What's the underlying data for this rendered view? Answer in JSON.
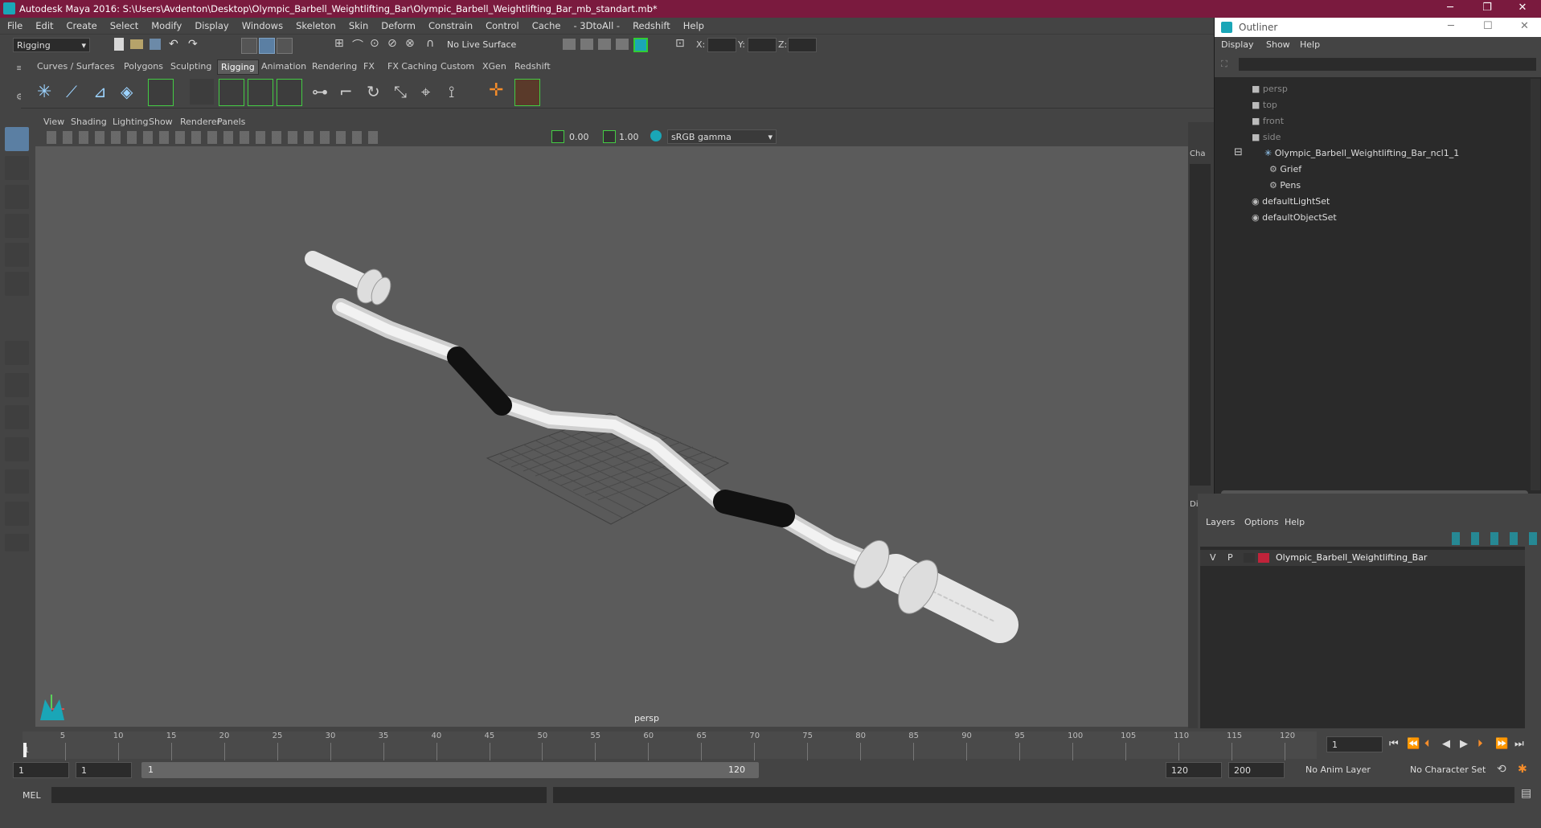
{
  "window": {
    "title": "Autodesk Maya 2016: S:\\Users\\Avdenton\\Desktop\\Olympic_Barbell_Weightlifting_Bar\\Olympic_Barbell_Weightlifting_Bar_mb_standart.mb*"
  },
  "menubar": [
    "File",
    "Edit",
    "Create",
    "Select",
    "Modify",
    "Display",
    "Windows",
    "Skeleton",
    "Skin",
    "Deform",
    "Constrain",
    "Control",
    "Cache",
    "- 3DtoAll -",
    "Redshift",
    "Help"
  ],
  "statusline": {
    "mode": "Rigging",
    "live_surface": "No Live Surface",
    "x_label": "X:",
    "y_label": "Y:",
    "z_label": "Z:"
  },
  "shelf_tabs": [
    "Curves / Surfaces",
    "Polygons",
    "Sculpting",
    "Rigging",
    "Animation",
    "Rendering",
    "FX",
    "FX Caching",
    "Custom",
    "XGen",
    "Redshift"
  ],
  "shelf_active": "Rigging",
  "panel_menu": [
    "View",
    "Shading",
    "Lighting",
    "Show",
    "Renderer",
    "Panels"
  ],
  "panel_tools": {
    "exposure": "0.00",
    "gamma": "1.00",
    "color_space": "sRGB gamma"
  },
  "viewport": {
    "camera_label": "persp"
  },
  "sideband": {
    "top_label": "Cha",
    "bottom_label": "Dis"
  },
  "outliner": {
    "title": "Outliner",
    "menu": [
      "Display",
      "Show",
      "Help"
    ],
    "items": [
      {
        "label": "persp",
        "dim": true
      },
      {
        "label": "top",
        "dim": true
      },
      {
        "label": "front",
        "dim": true
      },
      {
        "label": "side",
        "dim": true
      },
      {
        "label": "Olympic_Barbell_Weightlifting_Bar_ncl1_1",
        "dim": false
      },
      {
        "label": "Grief",
        "dim": false
      },
      {
        "label": "Pens",
        "dim": false
      },
      {
        "label": "defaultLightSet",
        "dim": false
      },
      {
        "label": "defaultObjectSet",
        "dim": false
      }
    ]
  },
  "layers": {
    "menu": [
      "Layers",
      "Options",
      "Help"
    ],
    "row": {
      "v": "V",
      "p": "P",
      "name": "Olympic_Barbell_Weightlifting_Bar",
      "color": "#c0233a"
    }
  },
  "timeline": {
    "ticks": [
      5,
      10,
      15,
      20,
      25,
      30,
      35,
      40,
      45,
      50,
      55,
      60,
      65,
      70,
      75,
      80,
      85,
      90,
      95,
      100,
      105,
      110,
      115,
      120
    ],
    "current_frame": "1",
    "current_field": "1"
  },
  "range": {
    "start": "1",
    "anim_start": "1",
    "range_start": "1",
    "range_end": "120",
    "end": "120",
    "anim_end": "200",
    "anim_layer": "No Anim Layer",
    "char_set": "No Character Set"
  },
  "cmdline": {
    "label": "MEL"
  }
}
